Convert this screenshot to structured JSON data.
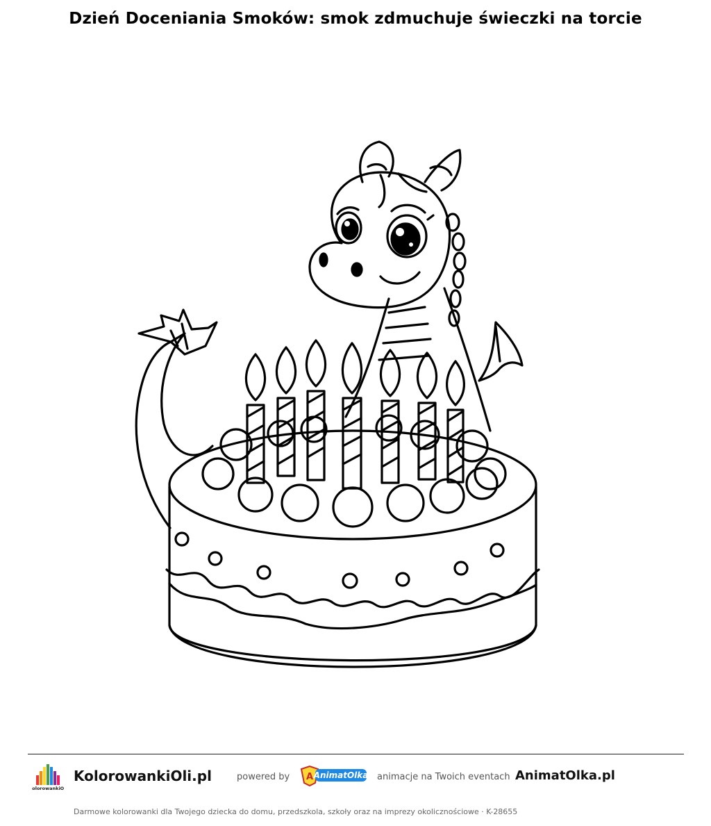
{
  "title": "Dzień Doceniania Smoków: smok zdmuchuje świeczki na torcie",
  "footer": {
    "brand": "KolorowankiOli.pl",
    "logo_text": "KolorowankiOli",
    "powered_by": "powered by",
    "partner_logo_text": "AnimatOlka",
    "tagline": "animacje na Twoich eventach",
    "partner_brand": "AnimatOlka.pl",
    "note": "Darmowe kolorowanki dla Twojego dziecka do domu, przedszkola, szkoły oraz na imprezy okolicznościowe  ·  K-28655"
  },
  "illustration": {
    "subject": "dragon-with-birthday-cake",
    "candle_count": 7
  }
}
